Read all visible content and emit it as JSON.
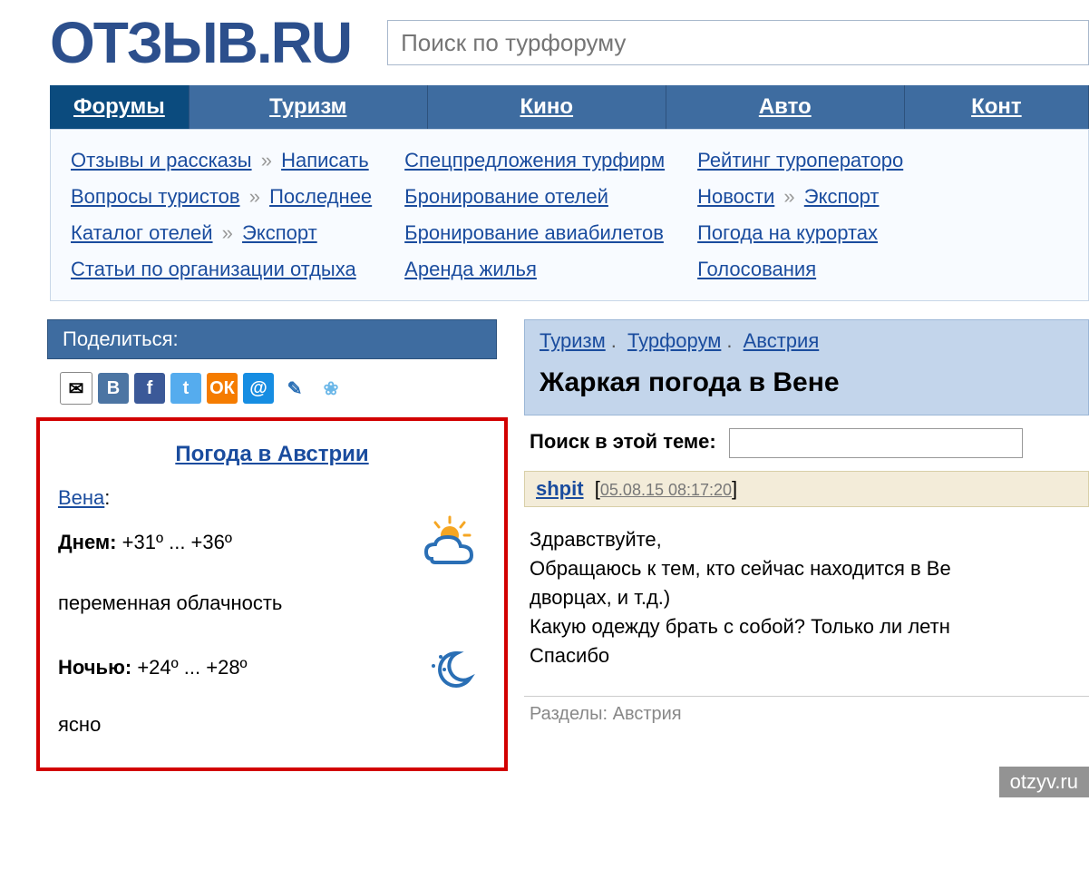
{
  "logo": "ОТЗЫВ.RU",
  "search": {
    "placeholder": "Поиск по турфоруму"
  },
  "nav": {
    "tabs": [
      "Форумы",
      "Туризм",
      "Кино",
      "Авто",
      "Конт"
    ]
  },
  "subnav": {
    "col0": {
      "l0": "Отзывы и рассказы",
      "l1": "Написать",
      "l2": "Вопросы туристов",
      "l3": "Последнее",
      "l4": "Каталог отелей",
      "l5": "Экспорт",
      "l6": "Статьи по организации отдыха",
      "sep": "»"
    },
    "col1": {
      "l0": "Спецпредложения турфирм",
      "l1": "Бронирование отелей",
      "l2": "Бронирование авиабилетов",
      "l3": "Аренда жилья"
    },
    "col2": {
      "l0": "Рейтинг туроператоро",
      "l1": "Новости",
      "l2": "Экспорт",
      "l3": "Погода на курортах",
      "l4": "Голосования",
      "sep": "»"
    }
  },
  "share": {
    "title": "Поделиться:"
  },
  "weather": {
    "title": "Погода в Австрии",
    "city": "Вена",
    "day_label": "Днем:",
    "day_value": "+31º ... +36º",
    "day_desc": "переменная облачность",
    "night_label": "Ночью:",
    "night_value": "+24º ... +28º",
    "night_desc": "ясно"
  },
  "breadcrumbs": {
    "a": "Туризм",
    "b": "Турфорум",
    "c": "Австрия"
  },
  "topic": {
    "title": "Жаркая погода в Вене"
  },
  "thread_search": {
    "label": "Поиск в этой теме:"
  },
  "post": {
    "user": "shpit",
    "timestamp": "05.08.15 08:17:20",
    "line0": "Здравствуйте,",
    "line1": "Обращаюсь к тем, кто сейчас находится в Ве",
    "line2": "дворцах, и т.д.)",
    "line3": "Какую одежду брать с собой? Только ли летн",
    "line4": "Спасибо",
    "sections_label": "Разделы:",
    "sections_value": "Австрия"
  },
  "watermark": "otzyv.ru"
}
